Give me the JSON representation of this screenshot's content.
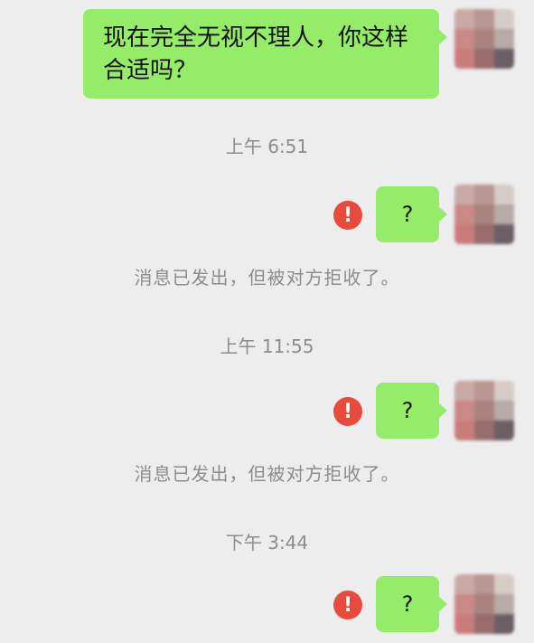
{
  "messages": [
    {
      "text": "现在完全无视不理人，你这样合适吗？"
    }
  ],
  "timestamps": [
    "上午 6:51",
    "上午 11:55",
    "下午 3:44"
  ],
  "retries": [
    {
      "text": "?",
      "system_notice": "消息已发出，但被对方拒收了。"
    },
    {
      "text": "?",
      "system_notice": "消息已发出，但被对方拒收了。"
    },
    {
      "text": "?"
    }
  ],
  "icons": {
    "warning": "exclamation-circle-icon"
  },
  "colors": {
    "bubble": "#95ec69",
    "warning": "#e84a3b",
    "background": "#ededed",
    "meta_text": "#8c8c8c"
  }
}
